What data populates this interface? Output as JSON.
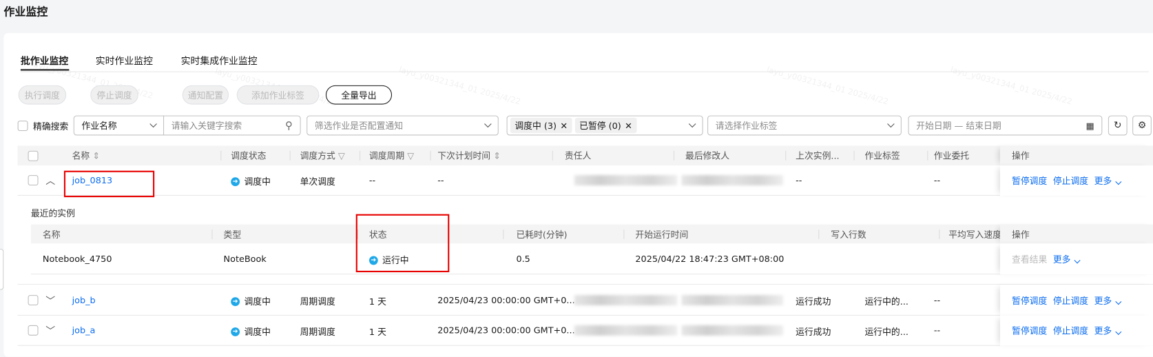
{
  "page_title": "作业监控",
  "tabs": [
    "批作业监控",
    "实时作业监控",
    "实时集成作业监控"
  ],
  "toolbar": {
    "run": "执行调度",
    "stop": "停止调度",
    "notify": "通知配置",
    "add_tag": "添加作业标签",
    "export": "全量导出"
  },
  "filters": {
    "exact_search": "精确搜索",
    "field_select": "作业名称",
    "keyword_placeholder": "请输入关键字搜索",
    "notify_placeholder": "筛选作业是否配置通知",
    "status_tags": [
      "调度中 (3)",
      "已暂停 (0)"
    ],
    "tag_placeholder": "请选择作业标签",
    "date_placeholder": "开始日期 — 结束日期"
  },
  "columns": [
    "名称",
    "调度状态",
    "调度方式",
    "调度周期",
    "下次计划时间",
    "责任人",
    "最后修改人",
    "上次实例...",
    "作业标签",
    "作业委托",
    "操作"
  ],
  "jobs": [
    {
      "name": "job_0813",
      "status": "调度中",
      "mode": "单次调度",
      "cycle": "--",
      "next": "--",
      "last": "--",
      "tag": "",
      "delegate": "--",
      "expanded": true
    },
    {
      "name": "job_b",
      "status": "调度中",
      "mode": "周期调度",
      "cycle": "1 天",
      "next": "2025/04/23 00:00:00 GMT+0...",
      "last": "运行成功",
      "tag": "运行中的...",
      "delegate": "--"
    },
    {
      "name": "job_a",
      "status": "调度中",
      "mode": "周期调度",
      "cycle": "1 天",
      "next": "2025/04/23 00:00:00 GMT+0...",
      "last": "运行成功",
      "tag": "运行中的...",
      "delegate": "--"
    }
  ],
  "row_actions": {
    "pause": "暂停调度",
    "stop": "停止调度",
    "more": "更多"
  },
  "instances": {
    "title": "最近的实例",
    "columns": [
      "名称",
      "类型",
      "状态",
      "已耗时(分钟)",
      "开始运行时间",
      "写入行数",
      "平均写入速度",
      "操作"
    ],
    "rows": [
      {
        "name": "Notebook_4750",
        "type": "NoteBook",
        "status": "运行中",
        "elapsed": "0.5",
        "start": "2025/04/22 18:47:23 GMT+08:00",
        "view": "查看结果",
        "more": "更多"
      }
    ]
  },
  "watermark": "layu_y00321344_01 2025/4/22",
  "colors": {
    "link": "#0a6cf0",
    "running": "#1fa8e8",
    "highlight": "#e80000"
  }
}
